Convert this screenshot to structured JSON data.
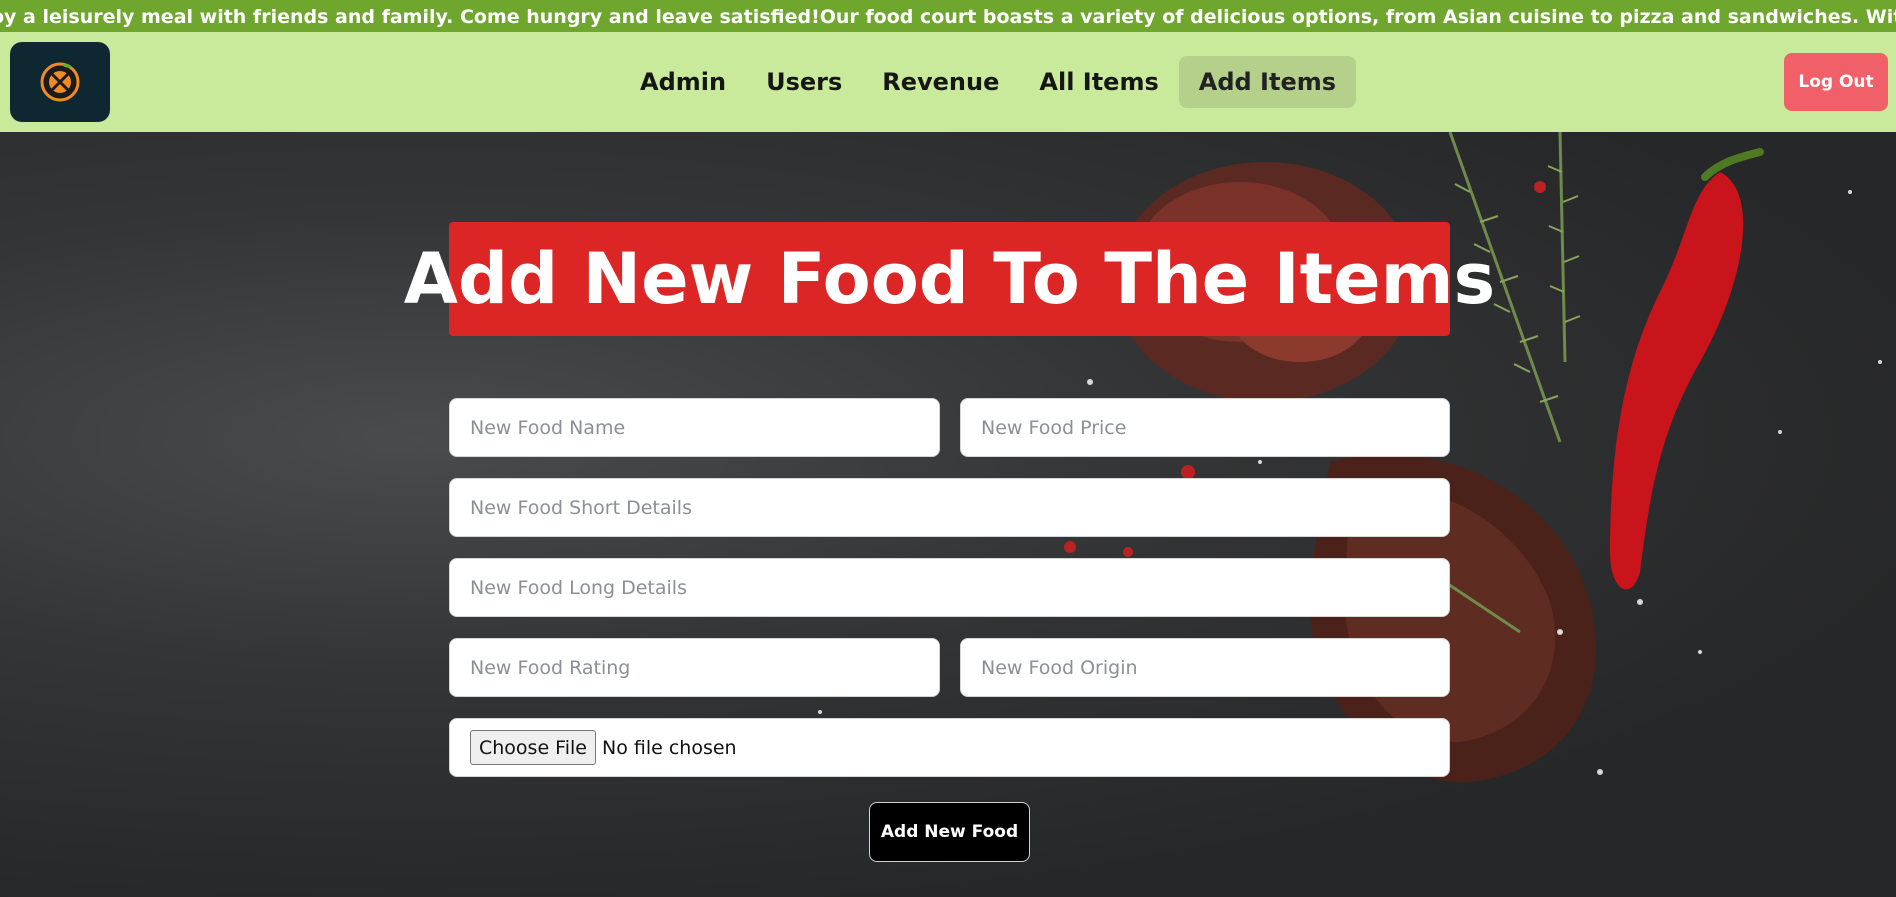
{
  "ticker": {
    "text": "oy a leisurely meal with friends and family. Come hungry and leave satisfied!Our food court boasts a variety of delicious options, from Asian cuisine to pizza and sandwiches. With quick service and plenty of sea"
  },
  "nav": {
    "logo_icon": "food-plate-icon",
    "links": [
      "Admin",
      "Users",
      "Revenue",
      "All Items",
      "Add Items"
    ],
    "active": "Add Items",
    "logout": "Log Out"
  },
  "form": {
    "title": "Add New Food To The Items",
    "name_placeholder": "New Food Name",
    "price_placeholder": "New Food Price",
    "short_placeholder": "New Food Short Details",
    "long_placeholder": "New Food Long Details",
    "rating_placeholder": "New Food Rating",
    "origin_placeholder": "New Food Origin",
    "file_button": "Choose File",
    "file_status": "No file chosen",
    "submit": "Add New Food"
  },
  "colors": {
    "ticker_bg": "#6fa62e",
    "navbar_bg": "#c9ea9a",
    "title_bg": "#dc2626",
    "logout_bg": "#f16068",
    "logo_bg": "#0f2731"
  }
}
